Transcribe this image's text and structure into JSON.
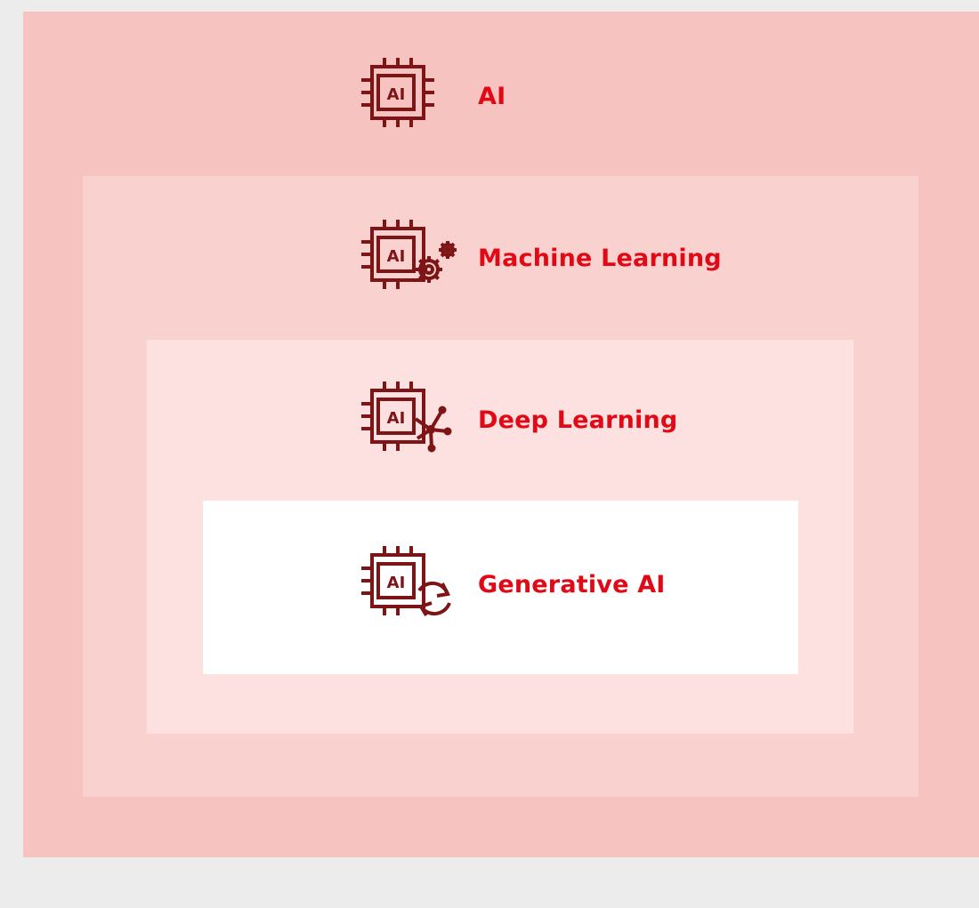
{
  "colors": {
    "page_background": "#ececec",
    "ai_background": "#f7c3c1",
    "ml_background": "#f9d2d0",
    "dl_background": "#fce1e0",
    "gen_background": "#ffffff",
    "label_color": "#e10915",
    "icon_color": "#7d1517"
  },
  "layers": {
    "ai": {
      "label": "AI",
      "icon": "ai-chip-icon",
      "chip_text": "AI"
    },
    "ml": {
      "label": "Machine Learning",
      "icon": "ai-chip-gears-icon",
      "chip_text": "AI"
    },
    "dl": {
      "label": "Deep Learning",
      "icon": "ai-chip-network-icon",
      "chip_text": "AI"
    },
    "gen": {
      "label": "Generative AI",
      "icon": "ai-chip-refresh-icon",
      "chip_text": "AI"
    }
  }
}
